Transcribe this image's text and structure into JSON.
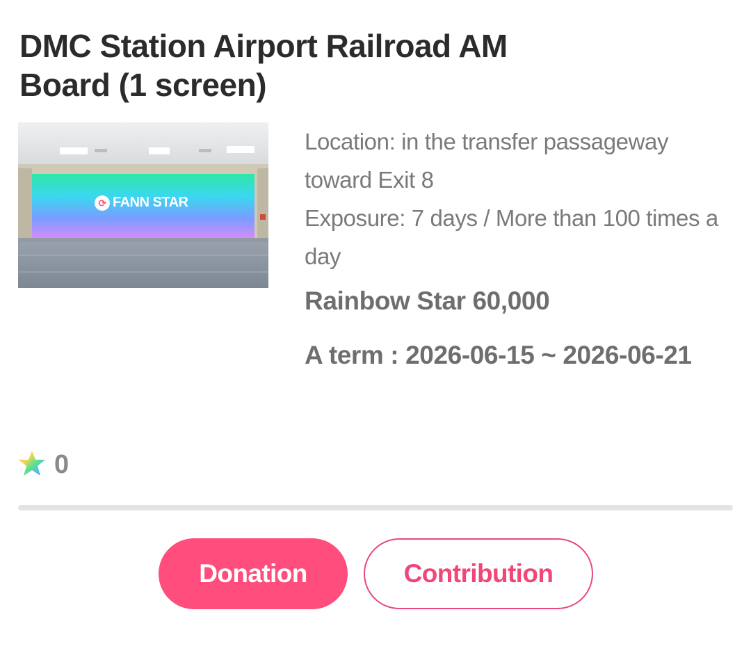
{
  "title": "DMC Station Airport Railroad AM Board (1 screen)",
  "thumbnail": {
    "brand_text": "FANN STAR",
    "colors": [
      "#2ee6a8",
      "#3ad8f0",
      "#7a9cff",
      "#d48cff"
    ]
  },
  "details": {
    "location": "Location: in the transfer passageway toward Exit 8",
    "exposure": "Exposure: 7 days / More than 100 times a day",
    "price": "Rainbow Star 60,000",
    "term": "A term : 2026-06-15 ~ 2026-06-21"
  },
  "stars": {
    "icon": "rainbow-star-icon",
    "count": "0"
  },
  "progress": {
    "fraction": 0
  },
  "actions": {
    "donation_label": "Donation",
    "contribution_label": "Contribution"
  },
  "colors": {
    "accent": "#ff4d7d",
    "accent_border": "#e8487a",
    "muted_text": "#7a7a7a",
    "strong_text": "#6e6e6e",
    "title_text": "#2b2b2b",
    "divider": "#e3e3e3"
  }
}
